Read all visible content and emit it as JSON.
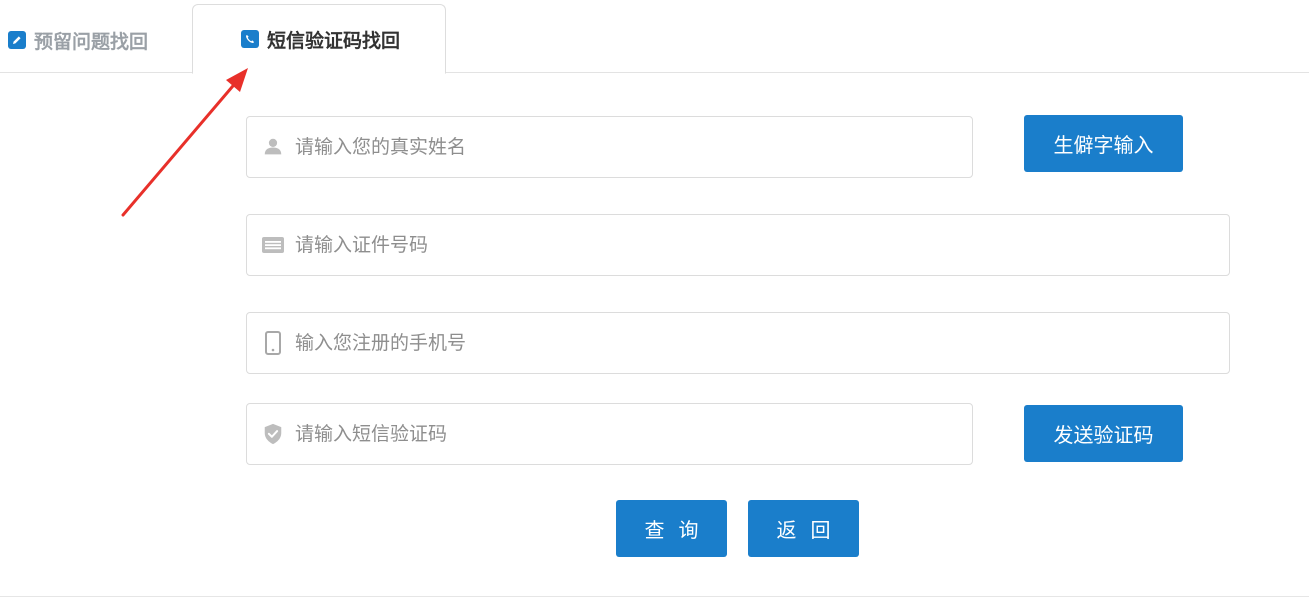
{
  "tabs": {
    "question": {
      "label": "预留问题找回",
      "icon": "edit-icon"
    },
    "sms": {
      "label": "短信验证码找回",
      "icon": "phone-icon",
      "active": true
    }
  },
  "form": {
    "name": {
      "placeholder": "请输入您的真实姓名",
      "value": "",
      "icon": "user-icon"
    },
    "id_number": {
      "placeholder": "请输入证件号码",
      "value": "",
      "icon": "id-card-icon"
    },
    "phone": {
      "placeholder": "输入您注册的手机号",
      "value": "",
      "icon": "mobile-icon"
    },
    "sms_code": {
      "placeholder": "请输入短信验证码",
      "value": "",
      "icon": "shield-check-icon"
    }
  },
  "buttons": {
    "rare_char": "生僻字输入",
    "send_code": "发送验证码",
    "query": "查询",
    "back": "返回"
  },
  "colors": {
    "accent": "#1a7ecb",
    "annotation": "#e8302a",
    "muted_text": "#9aa0a6",
    "border": "#dcdcdc"
  }
}
